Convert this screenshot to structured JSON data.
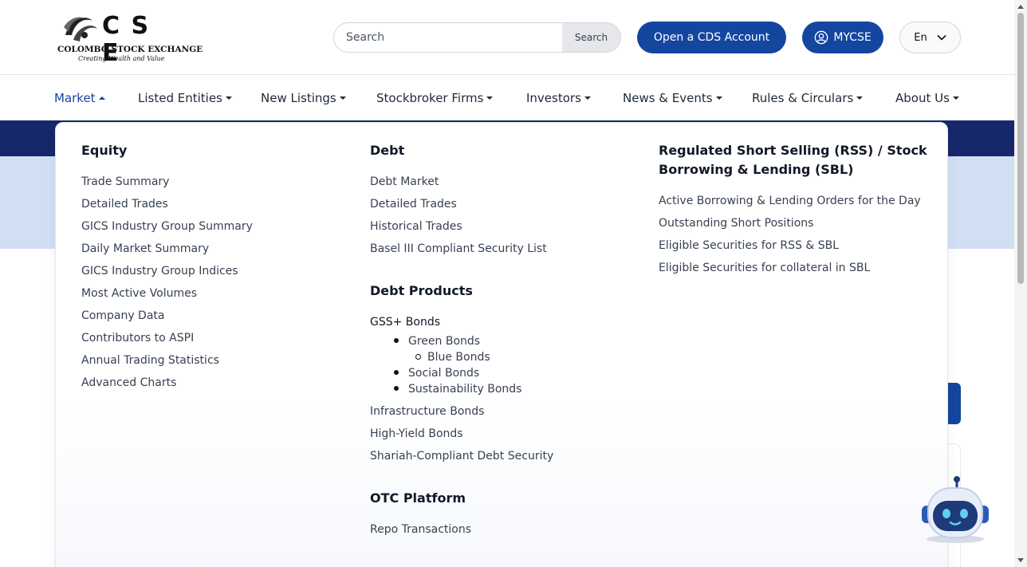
{
  "header": {
    "logo": {
      "letters": "C S E",
      "name": "COLOMBO STOCK EXCHANGE",
      "tagline": "Creating Wealth and Value"
    },
    "search": {
      "placeholder": "Search",
      "button_label": "Search"
    },
    "open_cds_label": "Open a CDS Account",
    "mycse_label": "MYCSE",
    "language": "En"
  },
  "nav": {
    "items": [
      {
        "label": "Market",
        "active": true
      },
      {
        "label": "Listed Entities"
      },
      {
        "label": "New Listings"
      },
      {
        "label": "Stockbroker Firms"
      },
      {
        "label": "Investors"
      },
      {
        "label": "News & Events"
      },
      {
        "label": "Rules & Circulars"
      },
      {
        "label": "About Us"
      }
    ]
  },
  "menu": {
    "equity": {
      "title": "Equity",
      "links": [
        "Trade Summary",
        "Detailed Trades",
        "GICS Industry Group Summary",
        "Daily Market Summary",
        "GICS Industry Group Indices",
        "Most Active Volumes",
        "Company Data",
        "Contributors to ASPI",
        "Annual Trading Statistics",
        "Advanced Charts"
      ]
    },
    "debt": {
      "title": "Debt",
      "links": [
        "Debt Market",
        "Detailed Trades",
        "Historical Trades",
        "Basel III Compliant Security List"
      ]
    },
    "debt_products": {
      "title": "Debt Products",
      "gss_title": "GSS+ Bonds",
      "green": "Green Bonds",
      "blue": "Blue Bonds",
      "social": "Social Bonds",
      "sustainability": "Sustainability Bonds",
      "links": [
        "Infrastructure Bonds",
        "High-Yield Bonds",
        "Shariah-Compliant Debt Security"
      ]
    },
    "otc": {
      "title": "OTC Platform",
      "links": [
        "Repo Transactions"
      ]
    },
    "rss": {
      "title_line1": "Regulated Short Selling (RSS) / Stock",
      "title_line2": "Borrowing & Lending (SBL)",
      "links": [
        "Active Borrowing & Lending Orders for the Day",
        "Outstanding Short Positions",
        "Eligible Securities for RSS & SBL",
        "Eligible Securities for collateral in SBL"
      ]
    }
  },
  "colors": {
    "brand": "#1446a0",
    "dark_band": "#16286b",
    "light_band": "#d2def3"
  },
  "icons": {
    "mycse": "user-circle-icon",
    "language": "chevron-down-icon",
    "chatbot": "robot-icon"
  }
}
